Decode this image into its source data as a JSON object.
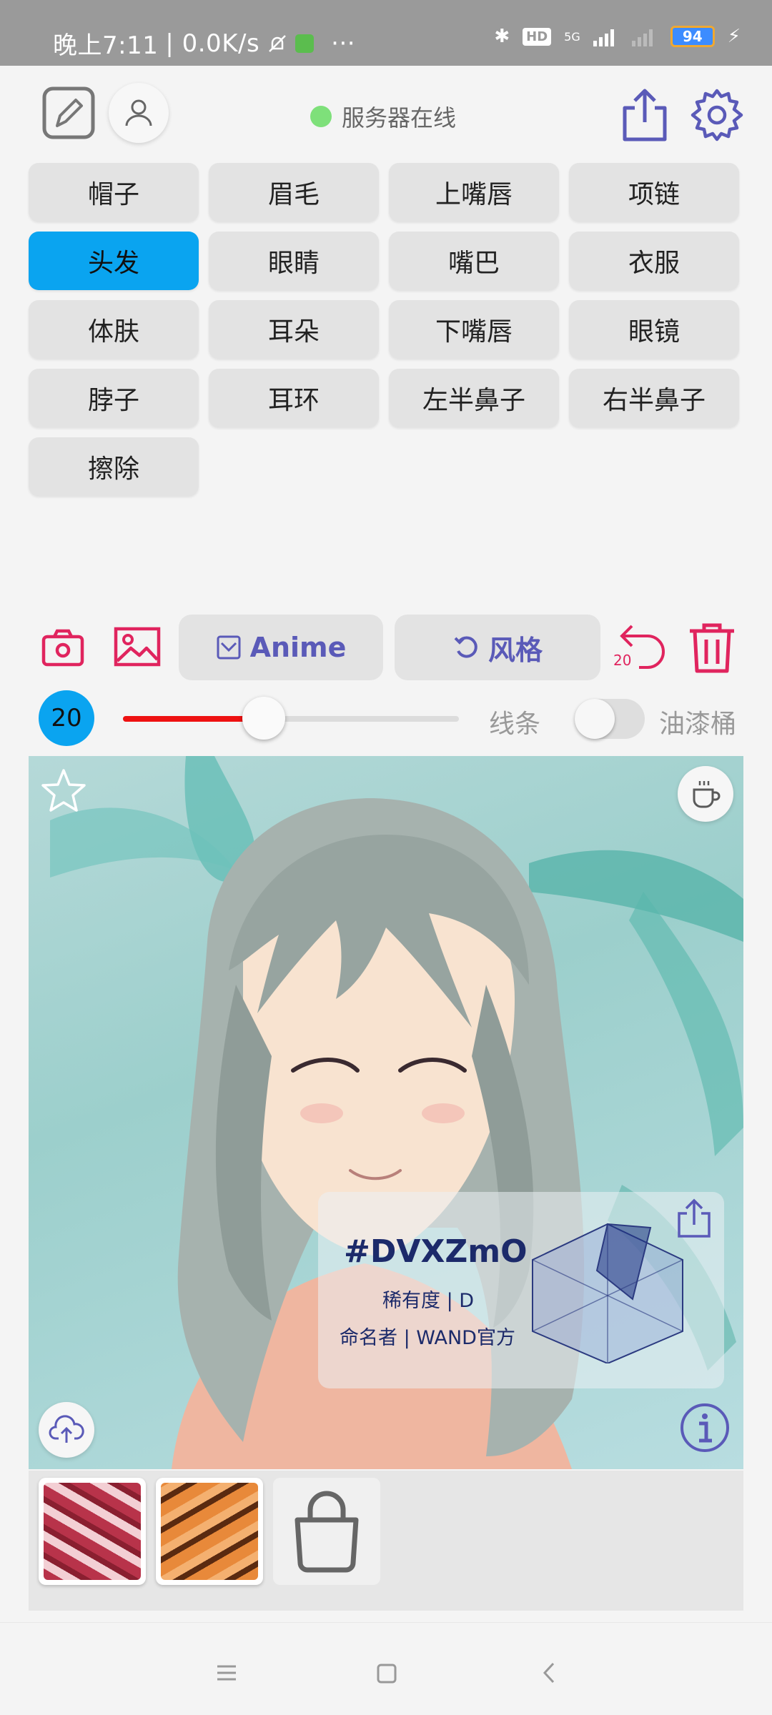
{
  "status_bar": {
    "time_text": "晚上7:11",
    "speed_text": "| 0.0K/s",
    "dots": "···",
    "hd": "HD",
    "network": "5G",
    "battery": "94"
  },
  "header": {
    "server_status": "服务器在线"
  },
  "parts": [
    {
      "label": "帽子"
    },
    {
      "label": "眉毛"
    },
    {
      "label": "上嘴唇"
    },
    {
      "label": "项链"
    },
    {
      "label": "头发"
    },
    {
      "label": "眼睛"
    },
    {
      "label": "嘴巴"
    },
    {
      "label": "衣服"
    },
    {
      "label": "体肤"
    },
    {
      "label": "耳朵"
    },
    {
      "label": "下嘴唇"
    },
    {
      "label": "眼镜"
    },
    {
      "label": "脖子"
    },
    {
      "label": "耳环"
    },
    {
      "label": "左半鼻子"
    },
    {
      "label": "右半鼻子"
    },
    {
      "label": "擦除"
    }
  ],
  "active_part": "头发",
  "toolbar": {
    "anime_label": "Anime",
    "style_label": "风格",
    "undo_count": "20"
  },
  "brush": {
    "size": "20",
    "slider_fraction": 0.42,
    "line_label": "线条",
    "bucket_label": "油漆桶",
    "bucket_enabled": false
  },
  "card": {
    "id": "#DVXZmO",
    "rarity": "稀有度 | D",
    "namer": "命名者 | WAND官方"
  },
  "colors": {
    "accent": "#0aa4f0",
    "red": "#e0245e",
    "purple": "#5a5ab8"
  }
}
